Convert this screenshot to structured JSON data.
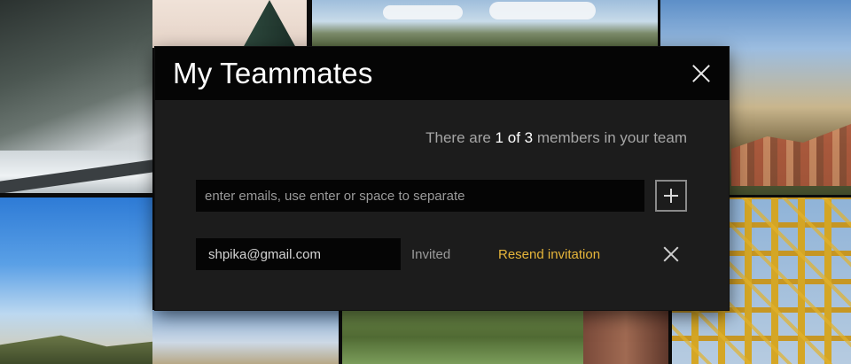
{
  "modal": {
    "title": "My Teammates",
    "count_prefix": "There are",
    "count_current": "1",
    "count_of": "of",
    "count_total": "3",
    "count_suffix": "members in your team",
    "email_input": {
      "value": "",
      "placeholder": "enter emails, use enter or space to separate"
    },
    "members": [
      {
        "email": "shpika@gmail.com",
        "status": "Invited",
        "action": "Resend invitation"
      }
    ]
  },
  "colors": {
    "accent_link": "#e6b53a",
    "modal_bg": "#1c1c1c",
    "header_bg": "#050505"
  },
  "icons": [
    "close-icon",
    "plus-icon",
    "remove-icon"
  ]
}
